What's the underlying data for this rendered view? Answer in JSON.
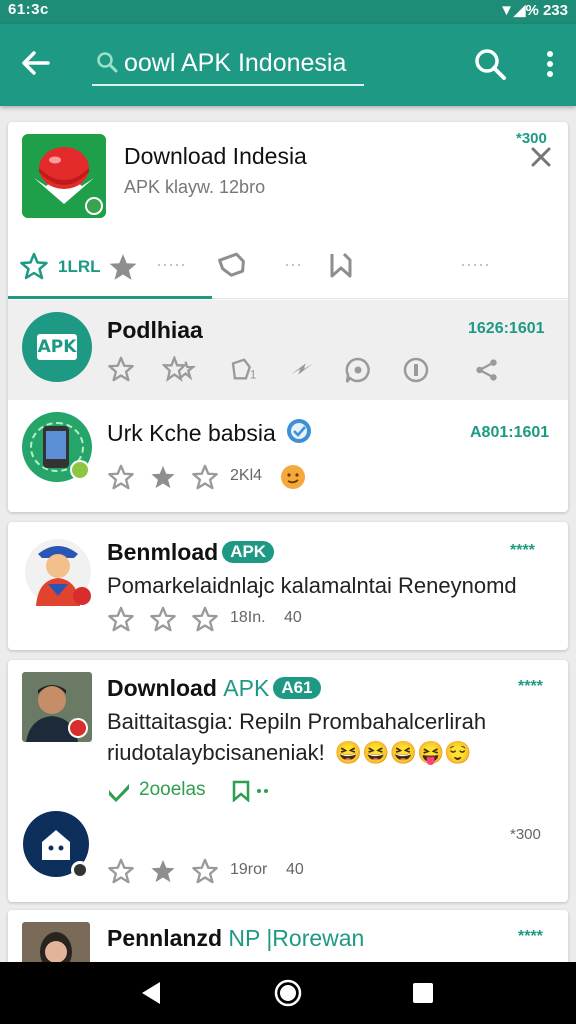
{
  "status_bar": {
    "left_text": "61:3c",
    "right_text": "233"
  },
  "app_bar": {
    "search_text": "oowl APK Indonesia"
  },
  "top_card": {
    "title": "Download Indesia",
    "subtitle": "APK klayw. 12bro",
    "corner_text": "*300",
    "tab_label": "1LRL",
    "tab_dots_1": "·····",
    "tab_dots_2": "···",
    "tab_dots_3": "·····"
  },
  "list_items": [
    {
      "title": "Podlhiaa",
      "meta": "1626:1601"
    },
    {
      "title": "Urk Kche babsia",
      "meta": "A801:1601",
      "count": "2Kl4"
    }
  ],
  "card_benmload": {
    "title": "Benmload",
    "badge": "APK",
    "rating": "****",
    "description": "Pomarkelaidnlajc kalamalntai Reneynomd",
    "count": "18In.",
    "extra": "40"
  },
  "card_download": {
    "title": "Download",
    "title_suffix": "APK",
    "badge": "A61",
    "rating": "****",
    "description_1": "Baittaitasgia: Repiln Prombahalcerlirah",
    "description_2": "riudotalaybcisaneniak!",
    "green_label": "2ooelas",
    "corner_text": "*300",
    "count": "19ror",
    "extra": "40"
  },
  "card_pennlanzd": {
    "title": "Pennlanzd",
    "subtitle": "NP |Rorewan",
    "rating": "****"
  },
  "colors": {
    "teal": "#1e9a84",
    "teal_dark": "#1f8c78",
    "green": "#2e9e4f",
    "grey_icon": "#9a9a9a"
  }
}
